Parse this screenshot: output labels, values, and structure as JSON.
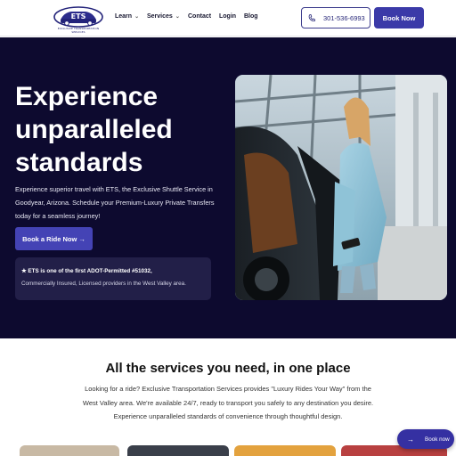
{
  "brand": {
    "logo_text": "EXCLUSIVE TRANSPORTATION SERVICES",
    "logo_mark": "ETS",
    "color_primary": "#3b3aa8",
    "color_dark": "#0d0a2f"
  },
  "nav": {
    "items": [
      {
        "label": "Learn",
        "has_dropdown": true
      },
      {
        "label": "Services",
        "has_dropdown": true
      },
      {
        "label": "Contact",
        "has_dropdown": false
      },
      {
        "label": "Login",
        "has_dropdown": false
      },
      {
        "label": "Blog",
        "has_dropdown": false
      }
    ],
    "phone": "301-536-6993",
    "book_now": "Book Now"
  },
  "hero": {
    "title": "Experience unparalleled standards",
    "subtitle": "Experience superior travel with ETS, the Exclusive Shuttle Service in Goodyear, Arizona. Schedule your Premium-Luxury Private Transfers today for a seamless journey!",
    "cta": "Book a Ride Now →",
    "note_bold": "★ ETS is one of the first ADOT-Permitted #51032,",
    "note_text": "Commercially Insured, Licensed providers in the West Valley area."
  },
  "services": {
    "title": "All the services you need, in one place",
    "text": "Looking for a ride? Exclusive Transportation Services provides \"Luxury Rides Your Way\" from the West Valley area. We're available 24/7, ready to transport you safely to any destination you desire. Experience unparalleled standards of convenience through thoughtful design."
  },
  "fab": {
    "label": "Book now",
    "icon": "arrow-right-icon"
  }
}
